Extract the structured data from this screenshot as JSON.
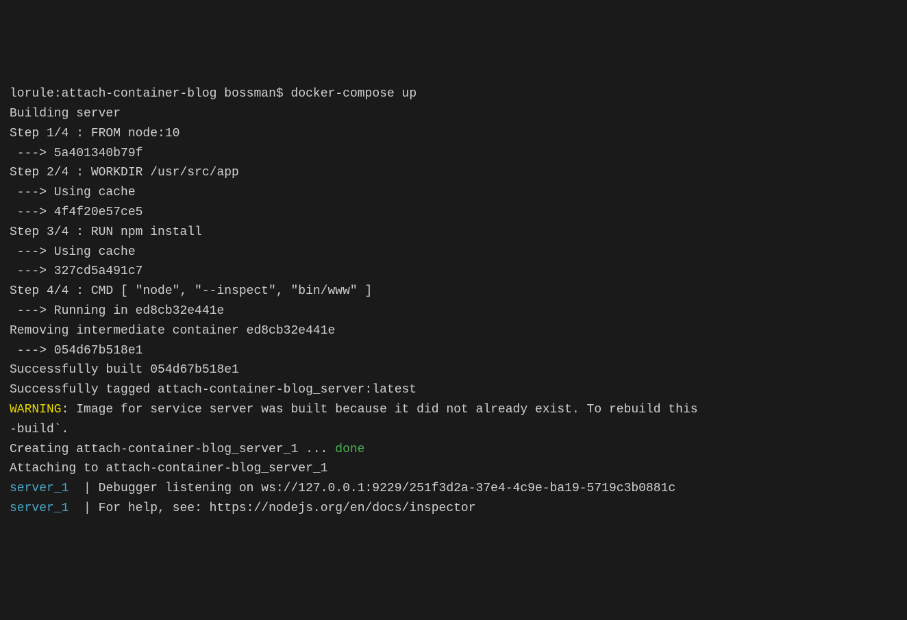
{
  "prompt": {
    "host": "lorule",
    "path": "attach-container-blog",
    "user": "bossman",
    "symbol": "$",
    "command": "docker-compose up"
  },
  "build": {
    "building": "Building server",
    "step1": "Step 1/4 : FROM node:10",
    "step1_hash": " ---> 5a401340b79f",
    "step2": "Step 2/4 : WORKDIR /usr/src/app",
    "step2_cache": " ---> Using cache",
    "step2_hash": " ---> 4f4f20e57ce5",
    "step3": "Step 3/4 : RUN npm install",
    "step3_cache": " ---> Using cache",
    "step3_hash": " ---> 327cd5a491c7",
    "step4": "Step 4/4 : CMD [ \"node\", \"--inspect\", \"bin/www\" ]",
    "step4_running": " ---> Running in ed8cb32e441e",
    "removing": "Removing intermediate container ed8cb32e441e",
    "step4_hash": " ---> 054d67b518e1",
    "blank": "",
    "success_built": "Successfully built 054d67b518e1",
    "success_tagged": "Successfully tagged attach-container-blog_server:latest"
  },
  "warning": {
    "label": "WARNING",
    "text": ": Image for service server was built because it did not already exist. To rebuild this",
    "text2": "-build`."
  },
  "creating": {
    "text": "Creating attach-container-blog_server_1 ... ",
    "done": "done"
  },
  "attaching": "Attaching to attach-container-blog_server_1",
  "logs": {
    "service": "server_1",
    "sep": "  | ",
    "line1": "Debugger listening on ws://127.0.0.1:9229/251f3d2a-37e4-4c9e-ba19-5719c3b0881c",
    "line2": "For help, see: https://nodejs.org/en/docs/inspector"
  }
}
